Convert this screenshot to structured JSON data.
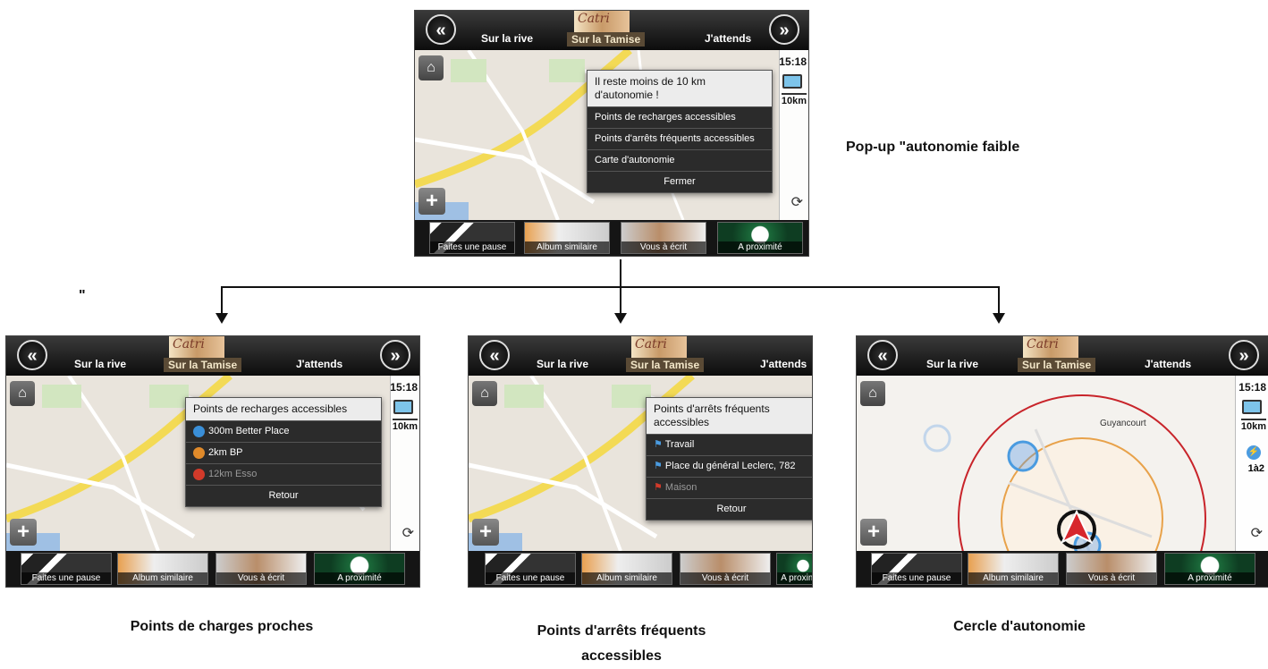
{
  "player": {
    "prev_icon": "rewind-icon",
    "next_icon": "forward-icon",
    "track_prev": "Sur la rive",
    "track_current": "Sur la Tamise",
    "track_next": "J'attends",
    "album_art_text": "Catri"
  },
  "status": {
    "time": "15:18",
    "range": "10km",
    "charge_info": "1à2"
  },
  "shortcuts": [
    "Faites une pause",
    "Album similaire",
    "Vous à écrit",
    "A proximité"
  ],
  "popup_main": {
    "title": "Il reste moins de 10 km d'autonomie !",
    "items": [
      "Points de recharges accessibles",
      "Points d'arrêts fréquents accessibles",
      "Carte d'autonomie",
      "Fermer"
    ]
  },
  "popup_charge": {
    "title": "Points de recharges accessibles",
    "items": [
      "300m  Better Place",
      "2km   BP",
      "12km  Esso"
    ],
    "back": "Retour",
    "colors": [
      "#3a8fd8",
      "#e08a2a",
      "#d23a2a"
    ]
  },
  "popup_stops": {
    "title": "Points d'arrêts fréquents accessibles",
    "items": [
      "Travail",
      "Place du général Leclerc, 782",
      "Maison"
    ],
    "back": "Retour"
  },
  "autonomy_map": {
    "town": "Guyancourt"
  },
  "captions": {
    "main": "Pop-up \"autonomie faible",
    "quote": "\"",
    "left": "Points de charges proches",
    "middle": "Points d'arrêts fréquents accessibles",
    "right": "Cercle d'autonomie"
  }
}
